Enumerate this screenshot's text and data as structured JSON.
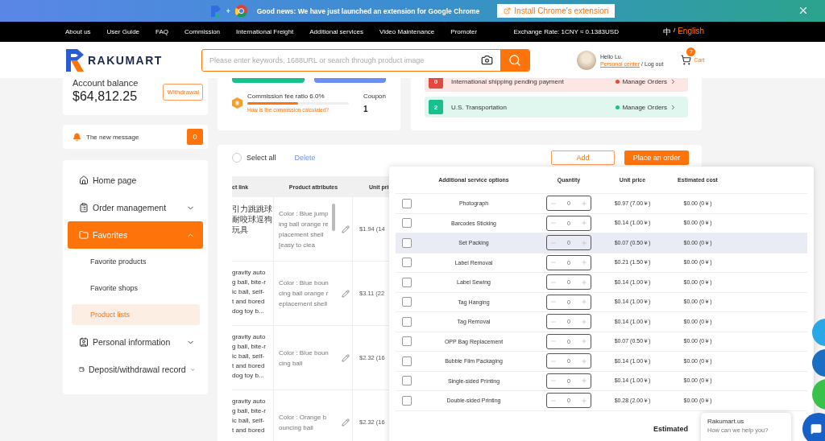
{
  "banner": {
    "plus": "+",
    "text": "Good news: We have just launched an extension for Google Chrome",
    "button": "Install Chrome's extension"
  },
  "nav": {
    "links": [
      "About us",
      "User Guide",
      "FAQ",
      "Commission",
      "International Freight",
      "Additional services",
      "Video Maintenance",
      "Promoter"
    ],
    "exchange_rate": "Exchange Rate: 1CNY ≈ 0.1383USD",
    "separator": "/",
    "languages": [
      {
        "label": "中",
        "selected": false
      },
      {
        "label": "English",
        "selected": true
      }
    ]
  },
  "header": {
    "logo": "RAKUMART",
    "search": {
      "placeholder": "Please enter keywords, 1688URL or search through product image"
    },
    "user": {
      "greeting": "Hello Lu.",
      "personal_center": "Personal center",
      "separator": "/",
      "logout": "Log out"
    },
    "cart": {
      "label": "Cart",
      "count": "7"
    }
  },
  "account": {
    "label": "Account balance",
    "amount": "$64,812.25",
    "button": "Withdrawal"
  },
  "messages": {
    "label": "The new message",
    "count": "0"
  },
  "sidebar": {
    "items": [
      {
        "label": "Home page",
        "kind": "link",
        "selected": false
      },
      {
        "label": "Order management",
        "kind": "group",
        "selected": false,
        "expanded": false
      },
      {
        "label": "Favorites",
        "kind": "group",
        "selected": true,
        "expanded": true,
        "children": [
          {
            "label": "Favorite products",
            "selected": false
          },
          {
            "label": "Favorite shops",
            "selected": false
          },
          {
            "label": "Product lists",
            "selected": true
          }
        ]
      },
      {
        "label": "Personal information",
        "kind": "group",
        "selected": false,
        "expanded": false
      },
      {
        "label": "Deposit/withdrawal record",
        "kind": "group",
        "selected": false,
        "expanded": false
      }
    ]
  },
  "commission": {
    "label": "Commission fee ratio 6.0%",
    "level": 0.5,
    "link": "How is the commission calculated?",
    "coupon_label": "Coupon",
    "coupon_count": "1"
  },
  "order_status": [
    {
      "count": "0",
      "label": "International shipping pending payment",
      "action": "Manage Orders",
      "color": "#e5483c"
    },
    {
      "count": "2",
      "label": "U.S. Transportation",
      "action": "Manage Orders",
      "color": "#17c08d"
    }
  ],
  "toolbar": {
    "select_all": {
      "label": "Select all",
      "checked": false
    },
    "delete": "Delete",
    "add": "Add",
    "place_order": "Place an order"
  },
  "product_table": {
    "columns": [
      "ct link",
      "Product attributes",
      "Unit pri"
    ],
    "rows": [
      {
        "name_lines": [
          "引力跳跳球",
          "耐咬球逗狗",
          "玩具"
        ],
        "attributes": "Color : Blue jumping ball orange replacement shell [easy to clea",
        "price": "$1.94 (14"
      },
      {
        "name_lines": [
          "gravity auto",
          "g ball, bite-r",
          "ic ball, self-",
          "t and bored",
          "dog toy b..."
        ],
        "attributes": "Color : Blue bouncing ball orange replacement shell",
        "price": "$3.11 (22"
      },
      {
        "name_lines": [
          "gravity auto",
          "g ball, bite-r",
          "ic ball, self-",
          "t and bored",
          "dog toy b..."
        ],
        "attributes": "Color : Blue bouncing ball",
        "price": "$2.32 (16"
      },
      {
        "name_lines": [
          "gravity auto",
          "g ball, bite-r",
          "ic ball, self-",
          "t and bored"
        ],
        "attributes": "Color : Orange bouncing ball",
        "price": "$2.32 (16"
      }
    ]
  },
  "service_popup": {
    "columns": [
      "Additional service options",
      "Quantity",
      "Unit price",
      "Estimated cost"
    ],
    "rows": [
      {
        "name": "Photograph",
        "checked": false,
        "highlighted": false,
        "quantity": "0",
        "unit_price": "$0.97 (7.00￥)",
        "estimated_cost": "$0.00 (0￥)"
      },
      {
        "name": "Barcodes Sticking",
        "checked": false,
        "highlighted": false,
        "quantity": "0",
        "unit_price": "$0.14 (1.00￥)",
        "estimated_cost": "$0.00 (0￥)"
      },
      {
        "name": "Set Packing",
        "checked": false,
        "highlighted": true,
        "quantity": "0",
        "unit_price": "$0.07 (0.50￥)",
        "estimated_cost": "$0.00 (0￥)"
      },
      {
        "name": "Label Removal",
        "checked": false,
        "highlighted": false,
        "quantity": "0",
        "unit_price": "$0.21 (1.50￥)",
        "estimated_cost": "$0.00 (0￥)"
      },
      {
        "name": "Label Sewing",
        "checked": false,
        "highlighted": false,
        "quantity": "0",
        "unit_price": "$0.14 (1.00￥)",
        "estimated_cost": "$0.00 (0￥)"
      },
      {
        "name": "Tag Hanging",
        "checked": false,
        "highlighted": false,
        "quantity": "0",
        "unit_price": "$0.14 (1.00￥)",
        "estimated_cost": "$0.00 (0￥)"
      },
      {
        "name": "Tag Removal",
        "checked": false,
        "highlighted": false,
        "quantity": "0",
        "unit_price": "$0.14 (1.00￥)",
        "estimated_cost": "$0.00 (0￥)"
      },
      {
        "name": "OPP Bag Replacement",
        "checked": false,
        "highlighted": false,
        "quantity": "0",
        "unit_price": "$0.07 (0.50￥)",
        "estimated_cost": "$0.00 (0￥)"
      },
      {
        "name": "Bubble Film Packaging",
        "checked": false,
        "highlighted": false,
        "quantity": "0",
        "unit_price": "$0.14 (1.00￥)",
        "estimated_cost": "$0.00 (0￥)"
      },
      {
        "name": "Single-sided Printing",
        "checked": false,
        "highlighted": false,
        "quantity": "0",
        "unit_price": "$0.14 (1.00￥)",
        "estimated_cost": "$0.00 (0￥)"
      },
      {
        "name": "Double-sided Printing",
        "checked": false,
        "highlighted": false,
        "quantity": "0",
        "unit_price": "$0.28 (2.00￥)",
        "estimated_cost": "$0.00 (0￥)"
      }
    ],
    "footer_label": "Estimated"
  },
  "chat": {
    "title": "Rakumart.us",
    "subtitle": "How can we help you?"
  }
}
